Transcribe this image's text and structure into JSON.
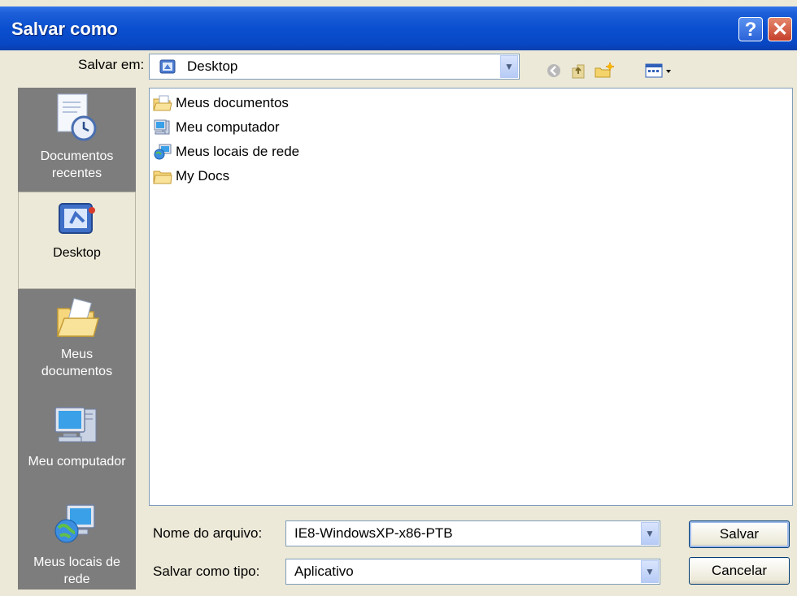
{
  "window": {
    "title": "Salvar como",
    "help_label": "?",
    "close_label": "✕"
  },
  "location": {
    "label": "Salvar em:",
    "value": "Desktop"
  },
  "toolbar": {
    "back": "back-icon",
    "up": "up-folder-icon",
    "new_folder": "new-folder-icon",
    "views": "views-menu-icon"
  },
  "places": [
    {
      "label_line1": "Documentos",
      "label_line2": "recentes",
      "icon": "recent-documents-icon"
    },
    {
      "label_line1": "Desktop",
      "label_line2": "",
      "icon": "desktop-icon"
    },
    {
      "label_line1": "Meus",
      "label_line2": "documentos",
      "icon": "my-documents-icon"
    },
    {
      "label_line1": "Meu computador",
      "label_line2": "",
      "icon": "my-computer-icon"
    },
    {
      "label_line1": "Meus locais de",
      "label_line2": "rede",
      "icon": "network-places-icon"
    }
  ],
  "files": [
    {
      "name": "Meus documentos",
      "icon": "documents-folder-icon"
    },
    {
      "name": "Meu computador",
      "icon": "computer-icon"
    },
    {
      "name": "Meus locais de rede",
      "icon": "network-icon"
    },
    {
      "name": "My Docs",
      "icon": "folder-icon"
    }
  ],
  "filename": {
    "label": "Nome do arquivo:",
    "value": "IE8-WindowsXP-x86-PTB"
  },
  "filetype": {
    "label": "Salvar como tipo:",
    "value": "Aplicativo"
  },
  "buttons": {
    "save": "Salvar",
    "cancel": "Cancelar"
  },
  "colors": {
    "title_bar": "#0a4fd0",
    "sidebar": "#7d7d7d",
    "dialog_bg": "#ece9d8"
  }
}
